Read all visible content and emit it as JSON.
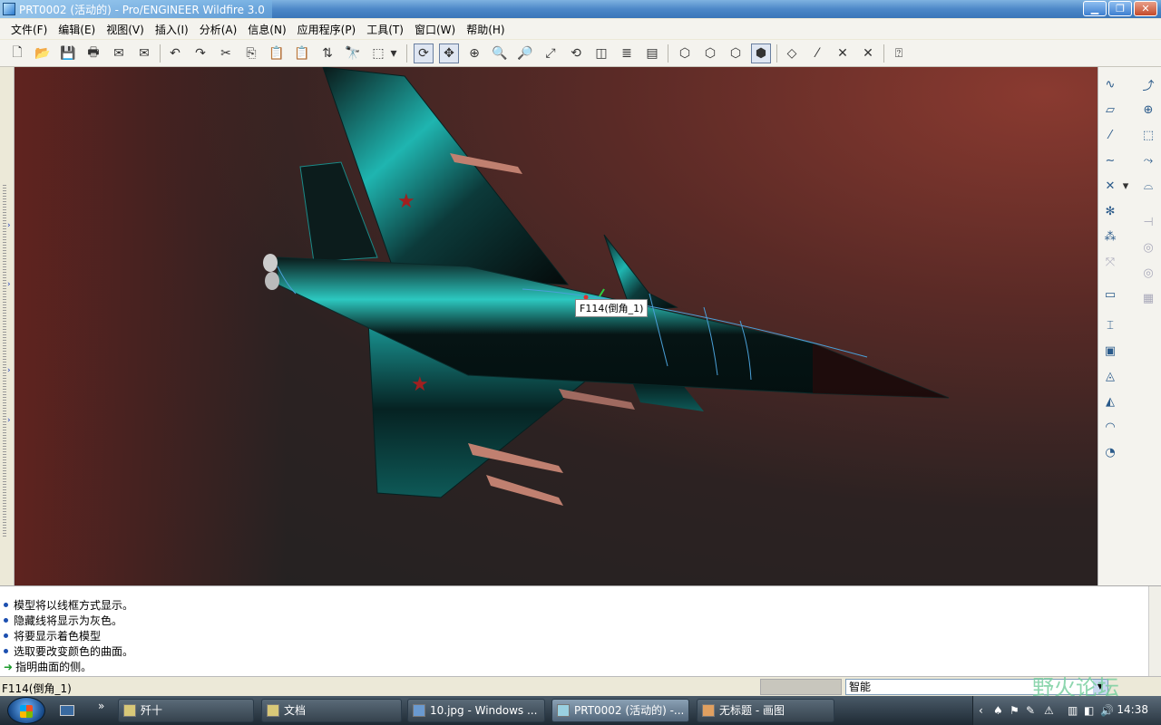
{
  "window": {
    "title": "PRT0002 (活动的) - Pro/ENGINEER Wildfire 3.0",
    "controls": {
      "minimize": "▁",
      "maximize": "❐",
      "close": "✕"
    }
  },
  "menu": [
    "文件(F)",
    "编辑(E)",
    "视图(V)",
    "插入(I)",
    "分析(A)",
    "信息(N)",
    "应用程序(P)",
    "工具(T)",
    "窗口(W)",
    "帮助(H)"
  ],
  "toolbar": {
    "new": "🗋",
    "open": "📂",
    "save": "💾",
    "print": "🖶",
    "send_mail": "✉",
    "send_link": "✉",
    "undo": "↶",
    "redo": "↷",
    "cut": "✂",
    "copy": "⎘",
    "paste": "📋",
    "paste_special": "📋",
    "regenerate": "⇅",
    "find": "🔭",
    "select_box": "⬚",
    "select_drop": "▾",
    "redraw": "⟳",
    "spin_center": "✥",
    "orient": "⊕",
    "zoom_in": "🔍",
    "zoom_out": "🔎",
    "refit": "⤢",
    "reorient": "⟲",
    "saved_views": "◫",
    "layers": "≣",
    "view_manager": "▤",
    "wireframe": "⬡",
    "hidden_line": "⬡",
    "no_hidden": "⬡",
    "shading": "⬢",
    "datum_planes": "◇",
    "datum_axes": "⁄",
    "datum_points": "✕",
    "csys": "✕",
    "context_help": "⍰"
  },
  "viewport": {
    "tooltip": "F114(倒角_1)"
  },
  "right_toolbar": {
    "col1": [
      "∿",
      "▱",
      "⁄",
      "∼",
      "✕",
      "✻",
      "⁂",
      "⤧",
      "▭",
      "⌶",
      "▣",
      "◬",
      "◭",
      "◠",
      "◔"
    ],
    "col2": [
      "⤴",
      "⊕",
      "⬚",
      "⤳",
      "⌓",
      "⊣",
      "◎",
      "◎",
      "▦"
    ]
  },
  "messages": [
    {
      "type": "info",
      "text": "模型将以线框方式显示。"
    },
    {
      "type": "info",
      "text": "隐藏线将显示为灰色。"
    },
    {
      "type": "info",
      "text": "将要显示着色模型"
    },
    {
      "type": "info",
      "text": "选取要改变颜色的曲面。"
    },
    {
      "type": "prompt",
      "text": "指明曲面的侧。"
    }
  ],
  "status": {
    "text": "F114(倒角_1)",
    "filter": "智能",
    "watermark": "野火论坛"
  },
  "taskbar": {
    "quick_launch": "»",
    "tasks": [
      {
        "label": "歼十",
        "active": false
      },
      {
        "label": "文档",
        "active": false
      },
      {
        "label": "10.jpg - Windows ...",
        "active": false
      },
      {
        "label": "PRT0002 (活动的) -...",
        "active": true
      },
      {
        "label": "无标题 - 画图",
        "active": false
      }
    ],
    "tray_chevron": "‹",
    "clock": "14:38"
  },
  "colors": {
    "viewport_red": "#8a3a30",
    "viewport_dark": "#222222",
    "aircraft_teal": "#1fb5b0",
    "titlebar": "#4d88c8"
  }
}
